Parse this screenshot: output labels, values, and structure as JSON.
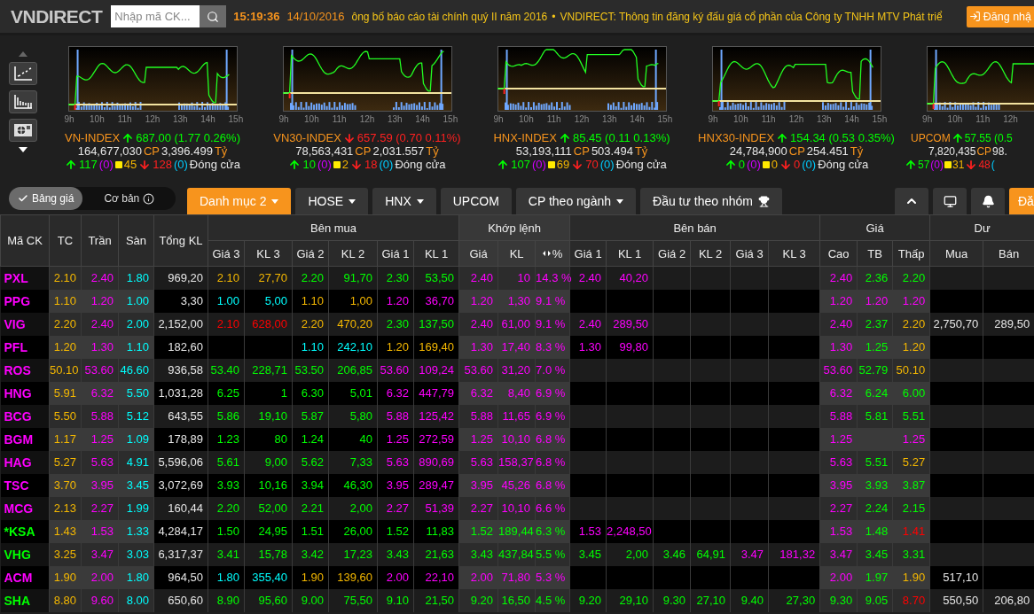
{
  "header": {
    "logo": "VNDIRECT",
    "search": {
      "placeholder": "Nhập mã CK..."
    },
    "time": "15:19:36",
    "date": "14/10/2016",
    "news": [
      "ông bố báo cáo tài chính quý II năm 2016",
      "VNDIRECT: Thông tin đăng ký đấu giá cổ phần của Công ty TNHH MTV Phát triể"
    ],
    "news_separator": "•",
    "login": "Đăng nhậ"
  },
  "indices": [
    {
      "name": "VN-INDEX",
      "kind": "up",
      "change": "687.00 (1.77 0.26%)",
      "volume": "164,677,030",
      "volume_unit": "CP",
      "value": "3,396.499",
      "value_unit": "Tỷ",
      "advances": "117",
      "ceiling_count": "(0)",
      "unchanged": "45",
      "declines": "128",
      "floor_count": "(0)",
      "status": "Đóng cửa",
      "hours": [
        "9h",
        "10h",
        "11h",
        "12h",
        "13h",
        "14h",
        "15h"
      ]
    },
    {
      "name": "VN30-INDEX",
      "kind": "down",
      "change": "657.59 (0.70 0.11%)",
      "volume": "78,563,431",
      "volume_unit": "CP",
      "value": "2,031.557",
      "value_unit": "Tỷ",
      "advances": "10",
      "ceiling_count": "(0)",
      "unchanged": "2",
      "declines": "18",
      "floor_count": "(0)",
      "status": "Đóng cửa",
      "hours": [
        "9h",
        "10h",
        "11h",
        "12h",
        "13h",
        "14h",
        "15h"
      ]
    },
    {
      "name": "HNX-INDEX",
      "kind": "up",
      "change": "85.45 (0.11 0.13%)",
      "volume": "53,193,111",
      "volume_unit": "CP",
      "value": "503.494",
      "value_unit": "Tỷ",
      "advances": "107",
      "ceiling_count": "(0)",
      "unchanged": "69",
      "declines": "70",
      "floor_count": "(0)",
      "status": "Đóng cửa",
      "hours": [
        "9h",
        "10h",
        "11h",
        "12h",
        "13h",
        "14h",
        "15h"
      ]
    },
    {
      "name": "HNX30-INDEX",
      "kind": "up",
      "change": "154.34 (0.53 0.35%)",
      "volume": "24,784,900",
      "volume_unit": "CP",
      "value": "254.451",
      "value_unit": "Tỷ",
      "advances": "0",
      "ceiling_count": "(0)",
      "unchanged": "0",
      "declines": "0",
      "floor_count": "(0)",
      "status": "Đóng cửa",
      "hours": [
        "9h",
        "10h",
        "11h",
        "12h",
        "13h",
        "14h",
        "15h"
      ]
    },
    {
      "name": "UPCOM",
      "kind": "up",
      "change": "57.55 (0.5",
      "volume": "7,820,435",
      "volume_unit": "CP",
      "value": "98.",
      "advances": "57",
      "ceiling_count": "(0)",
      "unchanged": "31",
      "declines": "48",
      "floor_count": "(",
      "hours": [
        "9h",
        "10h",
        "11h",
        "12h"
      ]
    }
  ],
  "view_toggle": [
    {
      "label": "Bảng giá",
      "selected": true
    },
    {
      "label": "Cơ bản",
      "selected": false
    }
  ],
  "tabs": [
    {
      "label": "Danh mục 2",
      "selected": true,
      "kind": "menu"
    },
    {
      "label": "HOSE",
      "selected": false,
      "kind": "menu"
    },
    {
      "label": "HNX",
      "selected": false,
      "kind": "menu"
    },
    {
      "label": "UPCOM",
      "selected": false,
      "kind": "plain"
    },
    {
      "label": "CP theo ngành",
      "selected": false,
      "kind": "menu"
    },
    {
      "label": "Đầu tư theo nhóm",
      "selected": false,
      "kind": "trophy"
    }
  ],
  "edge_button": "Đă",
  "table": {
    "columns": [
      {
        "label": "Mã CK"
      },
      {
        "label": "TC"
      },
      {
        "label": "Trần"
      },
      {
        "label": "Sàn"
      },
      {
        "label": "Tổng KL"
      },
      {
        "label": "Bên mua",
        "colspan": 6,
        "children": [
          {
            "label": "Giá 3"
          },
          {
            "label": "KL 3"
          },
          {
            "label": "Giá 2"
          },
          {
            "label": "KL 2"
          },
          {
            "label": "Giá 1"
          },
          {
            "label": "KL 1"
          }
        ]
      },
      {
        "label": "Khớp lệnh",
        "colspan": 3,
        "children": [
          {
            "label": "Giá"
          },
          {
            "label": "KL"
          },
          {
            "label": "%",
            "kind": "sort"
          }
        ]
      },
      {
        "label": "Bên bán",
        "colspan": 6,
        "children": [
          {
            "label": "Giá 1"
          },
          {
            "label": "KL 1"
          },
          {
            "label": "Giá 2"
          },
          {
            "label": "KL 2"
          },
          {
            "label": "Giá 3"
          },
          {
            "label": "KL 3"
          }
        ]
      },
      {
        "label": "Giá",
        "colspan": 3,
        "children": [
          {
            "label": "Cao"
          },
          {
            "label": "TB"
          },
          {
            "label": "Thấp"
          }
        ]
      },
      {
        "label": "Dư",
        "colspan": 2,
        "children": [
          {
            "label": "Mua"
          },
          {
            "label": "Bán"
          }
        ]
      }
    ],
    "rows": [
      {
        "cells": [
          {
            "v": "PXL",
            "color": "#ff00ff"
          },
          {
            "v": "2.10",
            "color": "#f5b800"
          },
          {
            "v": "2.40",
            "color": "#ff00ff"
          },
          {
            "v": "1.80",
            "color": "#00ffff"
          },
          {
            "v": "969,20",
            "color": "#e6e6e6"
          },
          {
            "v": "2.10",
            "color": "#f5b800"
          },
          {
            "v": "27,70",
            "color": "#f5b800"
          },
          {
            "v": "2.20",
            "color": "#00ff00"
          },
          {
            "v": "91,70",
            "color": "#00ff00"
          },
          {
            "v": "2.30",
            "color": "#00ff00"
          },
          {
            "v": "53,50",
            "color": "#00ff00"
          },
          {
            "v": "2.40",
            "color": "#ff00ff"
          },
          {
            "v": "10",
            "color": "#ff00ff"
          },
          {
            "v": "14.3 %",
            "color": "#ff00ff"
          },
          {
            "v": "2.40",
            "color": "#ff00ff"
          },
          {
            "v": "40,20",
            "color": "#ff00ff"
          },
          null,
          null,
          null,
          null,
          {
            "v": "2.40",
            "color": "#ff00ff"
          },
          {
            "v": "2.36",
            "color": "#00ff00"
          },
          {
            "v": "2.20",
            "color": "#00ff00"
          },
          null,
          null
        ]
      },
      {
        "cells": [
          {
            "v": "PPG",
            "color": "#ff00ff"
          },
          {
            "v": "1.10",
            "color": "#f5b800"
          },
          {
            "v": "1.20",
            "color": "#ff00ff"
          },
          {
            "v": "1.00",
            "color": "#00ffff"
          },
          {
            "v": "3,30",
            "color": "#e6e6e6"
          },
          {
            "v": "1.00",
            "color": "#00ffff"
          },
          {
            "v": "5,00",
            "color": "#00ffff"
          },
          {
            "v": "1.10",
            "color": "#f5b800"
          },
          {
            "v": "1,00",
            "color": "#f5b800"
          },
          {
            "v": "1.20",
            "color": "#ff00ff"
          },
          {
            "v": "36,70",
            "color": "#ff00ff"
          },
          {
            "v": "1.20",
            "color": "#ff00ff"
          },
          {
            "v": "1,30",
            "color": "#ff00ff"
          },
          {
            "v": "9.1 %",
            "color": "#ff00ff"
          },
          null,
          null,
          null,
          null,
          null,
          null,
          {
            "v": "1.20",
            "color": "#ff00ff"
          },
          {
            "v": "1.20",
            "color": "#ff00ff"
          },
          {
            "v": "1.20",
            "color": "#ff00ff"
          },
          null,
          null
        ]
      },
      {
        "cells": [
          {
            "v": "VIG",
            "color": "#ff00ff"
          },
          {
            "v": "2.20",
            "color": "#f5b800"
          },
          {
            "v": "2.40",
            "color": "#ff00ff"
          },
          {
            "v": "2.00",
            "color": "#00ffff"
          },
          {
            "v": "2,152,00",
            "color": "#e6e6e6"
          },
          {
            "v": "2.10",
            "color": "#ff0000"
          },
          {
            "v": "628,00",
            "color": "#ff0000"
          },
          {
            "v": "2.20",
            "color": "#f5b800"
          },
          {
            "v": "470,20",
            "color": "#f5b800"
          },
          {
            "v": "2.30",
            "color": "#00ff00"
          },
          {
            "v": "137,50",
            "color": "#00ff00"
          },
          {
            "v": "2.40",
            "color": "#ff00ff"
          },
          {
            "v": "61,00",
            "color": "#ff00ff"
          },
          {
            "v": "9.1 %",
            "color": "#ff00ff"
          },
          {
            "v": "2.40",
            "color": "#ff00ff"
          },
          {
            "v": "289,50",
            "color": "#ff00ff"
          },
          null,
          null,
          null,
          null,
          {
            "v": "2.40",
            "color": "#ff00ff"
          },
          {
            "v": "2.37",
            "color": "#00ff00"
          },
          {
            "v": "2.20",
            "color": "#f5b800"
          },
          {
            "v": "2,750,70",
            "color": "#e6e6e6"
          },
          {
            "v": "289,50",
            "color": "#e6e6e6"
          }
        ]
      },
      {
        "cells": [
          {
            "v": "PFL",
            "color": "#ff00ff"
          },
          {
            "v": "1.20",
            "color": "#f5b800"
          },
          {
            "v": "1.30",
            "color": "#ff00ff"
          },
          {
            "v": "1.10",
            "color": "#00ffff"
          },
          {
            "v": "182,60",
            "color": "#e6e6e6"
          },
          null,
          null,
          {
            "v": "1.10",
            "color": "#00ffff"
          },
          {
            "v": "242,10",
            "color": "#00ffff"
          },
          {
            "v": "1.20",
            "color": "#f5b800"
          },
          {
            "v": "169,40",
            "color": "#f5b800"
          },
          {
            "v": "1.30",
            "color": "#ff00ff"
          },
          {
            "v": "17,40",
            "color": "#ff00ff"
          },
          {
            "v": "8.3 %",
            "color": "#ff00ff"
          },
          {
            "v": "1.30",
            "color": "#ff00ff"
          },
          {
            "v": "99,80",
            "color": "#ff00ff"
          },
          null,
          null,
          null,
          null,
          {
            "v": "1.30",
            "color": "#ff00ff"
          },
          {
            "v": "1.25",
            "color": "#00ff00"
          },
          {
            "v": "1.20",
            "color": "#f5b800"
          },
          null,
          null
        ]
      },
      {
        "cells": [
          {
            "v": "ROS",
            "color": "#ff00ff"
          },
          {
            "v": "50.10",
            "color": "#f5b800"
          },
          {
            "v": "53.60",
            "color": "#ff00ff"
          },
          {
            "v": "46.60",
            "color": "#00ffff"
          },
          {
            "v": "936,58",
            "color": "#e6e6e6"
          },
          {
            "v": "53.40",
            "color": "#00ff00"
          },
          {
            "v": "228,71",
            "color": "#00ff00"
          },
          {
            "v": "53.50",
            "color": "#00ff00"
          },
          {
            "v": "206,85",
            "color": "#00ff00"
          },
          {
            "v": "53.60",
            "color": "#ff00ff"
          },
          {
            "v": "109,24",
            "color": "#ff00ff"
          },
          {
            "v": "53.60",
            "color": "#ff00ff"
          },
          {
            "v": "31,20",
            "color": "#ff00ff"
          },
          {
            "v": "7.0 %",
            "color": "#ff00ff"
          },
          null,
          null,
          null,
          null,
          null,
          null,
          {
            "v": "53.60",
            "color": "#ff00ff"
          },
          {
            "v": "52.79",
            "color": "#00ff00"
          },
          {
            "v": "50.10",
            "color": "#f5b800"
          },
          null,
          null
        ]
      },
      {
        "cells": [
          {
            "v": "HNG",
            "color": "#ff00ff"
          },
          {
            "v": "5.91",
            "color": "#f5b800"
          },
          {
            "v": "6.32",
            "color": "#ff00ff"
          },
          {
            "v": "5.50",
            "color": "#00ffff"
          },
          {
            "v": "1,031,28",
            "color": "#e6e6e6"
          },
          {
            "v": "6.25",
            "color": "#00ff00"
          },
          {
            "v": "1",
            "color": "#00ff00"
          },
          {
            "v": "6.30",
            "color": "#00ff00"
          },
          {
            "v": "5,01",
            "color": "#00ff00"
          },
          {
            "v": "6.32",
            "color": "#ff00ff"
          },
          {
            "v": "447,79",
            "color": "#ff00ff"
          },
          {
            "v": "6.32",
            "color": "#ff00ff"
          },
          {
            "v": "8,40",
            "color": "#ff00ff"
          },
          {
            "v": "6.9 %",
            "color": "#ff00ff"
          },
          null,
          null,
          null,
          null,
          null,
          null,
          {
            "v": "6.32",
            "color": "#ff00ff"
          },
          {
            "v": "6.24",
            "color": "#00ff00"
          },
          {
            "v": "6.00",
            "color": "#00ff00"
          },
          null,
          null
        ]
      },
      {
        "cells": [
          {
            "v": "BCG",
            "color": "#ff00ff"
          },
          {
            "v": "5.50",
            "color": "#f5b800"
          },
          {
            "v": "5.88",
            "color": "#ff00ff"
          },
          {
            "v": "5.12",
            "color": "#00ffff"
          },
          {
            "v": "643,55",
            "color": "#e6e6e6"
          },
          {
            "v": "5.86",
            "color": "#00ff00"
          },
          {
            "v": "19,10",
            "color": "#00ff00"
          },
          {
            "v": "5.87",
            "color": "#00ff00"
          },
          {
            "v": "5,80",
            "color": "#00ff00"
          },
          {
            "v": "5.88",
            "color": "#ff00ff"
          },
          {
            "v": "125,42",
            "color": "#ff00ff"
          },
          {
            "v": "5.88",
            "color": "#ff00ff"
          },
          {
            "v": "11,65",
            "color": "#ff00ff"
          },
          {
            "v": "6.9 %",
            "color": "#ff00ff"
          },
          null,
          null,
          null,
          null,
          null,
          null,
          {
            "v": "5.88",
            "color": "#ff00ff"
          },
          {
            "v": "5.81",
            "color": "#00ff00"
          },
          {
            "v": "5.51",
            "color": "#00ff00"
          },
          null,
          null
        ]
      },
      {
        "cells": [
          {
            "v": "BGM",
            "color": "#ff00ff"
          },
          {
            "v": "1.17",
            "color": "#f5b800"
          },
          {
            "v": "1.25",
            "color": "#ff00ff"
          },
          {
            "v": "1.09",
            "color": "#00ffff"
          },
          {
            "v": "178,89",
            "color": "#e6e6e6"
          },
          {
            "v": "1.23",
            "color": "#00ff00"
          },
          {
            "v": "80",
            "color": "#00ff00"
          },
          {
            "v": "1.24",
            "color": "#00ff00"
          },
          {
            "v": "40",
            "color": "#00ff00"
          },
          {
            "v": "1.25",
            "color": "#ff00ff"
          },
          {
            "v": "272,59",
            "color": "#ff00ff"
          },
          {
            "v": "1.25",
            "color": "#ff00ff"
          },
          {
            "v": "10,10",
            "color": "#ff00ff"
          },
          {
            "v": "6.8 %",
            "color": "#ff00ff"
          },
          null,
          null,
          null,
          null,
          null,
          null,
          {
            "v": "1.25",
            "color": "#ff00ff"
          },
          null,
          {
            "v": "1.25",
            "color": "#ff00ff"
          },
          null,
          null
        ]
      },
      {
        "cells": [
          {
            "v": "HAG",
            "color": "#ff00ff"
          },
          {
            "v": "5.27",
            "color": "#f5b800"
          },
          {
            "v": "5.63",
            "color": "#ff00ff"
          },
          {
            "v": "4.91",
            "color": "#00ffff"
          },
          {
            "v": "5,596,06",
            "color": "#e6e6e6"
          },
          {
            "v": "5.61",
            "color": "#00ff00"
          },
          {
            "v": "9,00",
            "color": "#00ff00"
          },
          {
            "v": "5.62",
            "color": "#00ff00"
          },
          {
            "v": "7,33",
            "color": "#00ff00"
          },
          {
            "v": "5.63",
            "color": "#ff00ff"
          },
          {
            "v": "890,69",
            "color": "#ff00ff"
          },
          {
            "v": "5.63",
            "color": "#ff00ff"
          },
          {
            "v": "158,37",
            "color": "#ff00ff"
          },
          {
            "v": "6.8 %",
            "color": "#ff00ff"
          },
          null,
          null,
          null,
          null,
          null,
          null,
          {
            "v": "5.63",
            "color": "#ff00ff"
          },
          {
            "v": "5.51",
            "color": "#00ff00"
          },
          {
            "v": "5.27",
            "color": "#f5b800"
          },
          null,
          null
        ]
      },
      {
        "cells": [
          {
            "v": "TSC",
            "color": "#ff00ff"
          },
          {
            "v": "3.70",
            "color": "#f5b800"
          },
          {
            "v": "3.95",
            "color": "#ff00ff"
          },
          {
            "v": "3.45",
            "color": "#00ffff"
          },
          {
            "v": "3,072,69",
            "color": "#e6e6e6"
          },
          {
            "v": "3.93",
            "color": "#00ff00"
          },
          {
            "v": "10,16",
            "color": "#00ff00"
          },
          {
            "v": "3.94",
            "color": "#00ff00"
          },
          {
            "v": "46,30",
            "color": "#00ff00"
          },
          {
            "v": "3.95",
            "color": "#ff00ff"
          },
          {
            "v": "289,47",
            "color": "#ff00ff"
          },
          {
            "v": "3.95",
            "color": "#ff00ff"
          },
          {
            "v": "45,26",
            "color": "#ff00ff"
          },
          {
            "v": "6.8 %",
            "color": "#ff00ff"
          },
          null,
          null,
          null,
          null,
          null,
          null,
          {
            "v": "3.95",
            "color": "#ff00ff"
          },
          {
            "v": "3.93",
            "color": "#00ff00"
          },
          {
            "v": "3.87",
            "color": "#00ff00"
          },
          null,
          null
        ]
      },
      {
        "cells": [
          {
            "v": "MCG",
            "color": "#ff00ff"
          },
          {
            "v": "2.13",
            "color": "#f5b800"
          },
          {
            "v": "2.27",
            "color": "#ff00ff"
          },
          {
            "v": "1.99",
            "color": "#00ffff"
          },
          {
            "v": "160,44",
            "color": "#e6e6e6"
          },
          {
            "v": "2.20",
            "color": "#00ff00"
          },
          {
            "v": "52,00",
            "color": "#00ff00"
          },
          {
            "v": "2.21",
            "color": "#00ff00"
          },
          {
            "v": "2,00",
            "color": "#00ff00"
          },
          {
            "v": "2.27",
            "color": "#ff00ff"
          },
          {
            "v": "51,39",
            "color": "#ff00ff"
          },
          {
            "v": "2.27",
            "color": "#ff00ff"
          },
          {
            "v": "10,10",
            "color": "#ff00ff"
          },
          {
            "v": "6.6 %",
            "color": "#ff00ff"
          },
          null,
          null,
          null,
          null,
          null,
          null,
          {
            "v": "2.27",
            "color": "#ff00ff"
          },
          {
            "v": "2.24",
            "color": "#00ff00"
          },
          {
            "v": "2.15",
            "color": "#00ff00"
          },
          null,
          null
        ]
      },
      {
        "cells": [
          {
            "v": "*KSA",
            "color": "#00ff00"
          },
          {
            "v": "1.43",
            "color": "#f5b800"
          },
          {
            "v": "1.53",
            "color": "#ff00ff"
          },
          {
            "v": "1.33",
            "color": "#00ffff"
          },
          {
            "v": "4,284,17",
            "color": "#e6e6e6"
          },
          {
            "v": "1.50",
            "color": "#00ff00"
          },
          {
            "v": "24,95",
            "color": "#00ff00"
          },
          {
            "v": "1.51",
            "color": "#00ff00"
          },
          {
            "v": "26,00",
            "color": "#00ff00"
          },
          {
            "v": "1.52",
            "color": "#00ff00"
          },
          {
            "v": "11,83",
            "color": "#00ff00"
          },
          {
            "v": "1.52",
            "color": "#00ff00"
          },
          {
            "v": "189,44",
            "color": "#00ff00"
          },
          {
            "v": "6.3 %",
            "color": "#00ff00"
          },
          {
            "v": "1.53",
            "color": "#ff00ff"
          },
          {
            "v": "2,248,50",
            "color": "#ff00ff"
          },
          null,
          null,
          null,
          null,
          {
            "v": "1.53",
            "color": "#ff00ff"
          },
          {
            "v": "1.48",
            "color": "#00ff00"
          },
          {
            "v": "1.41",
            "color": "#ff0000"
          },
          null,
          null
        ]
      },
      {
        "cells": [
          {
            "v": "VHG",
            "color": "#00ff00"
          },
          {
            "v": "3.25",
            "color": "#f5b800"
          },
          {
            "v": "3.47",
            "color": "#ff00ff"
          },
          {
            "v": "3.03",
            "color": "#00ffff"
          },
          {
            "v": "6,317,37",
            "color": "#e6e6e6"
          },
          {
            "v": "3.41",
            "color": "#00ff00"
          },
          {
            "v": "15,78",
            "color": "#00ff00"
          },
          {
            "v": "3.42",
            "color": "#00ff00"
          },
          {
            "v": "17,23",
            "color": "#00ff00"
          },
          {
            "v": "3.43",
            "color": "#00ff00"
          },
          {
            "v": "21,63",
            "color": "#00ff00"
          },
          {
            "v": "3.43",
            "color": "#00ff00"
          },
          {
            "v": "437,84",
            "color": "#00ff00"
          },
          {
            "v": "5.5 %",
            "color": "#00ff00"
          },
          {
            "v": "3.45",
            "color": "#00ff00"
          },
          {
            "v": "2,00",
            "color": "#00ff00"
          },
          {
            "v": "3.46",
            "color": "#00ff00"
          },
          {
            "v": "64,91",
            "color": "#00ff00"
          },
          {
            "v": "3.47",
            "color": "#ff00ff"
          },
          {
            "v": "181,32",
            "color": "#ff00ff"
          },
          {
            "v": "3.47",
            "color": "#ff00ff"
          },
          {
            "v": "3.45",
            "color": "#00ff00"
          },
          {
            "v": "3.31",
            "color": "#00ff00"
          },
          null,
          null
        ]
      },
      {
        "cells": [
          {
            "v": "ACM",
            "color": "#ff00ff"
          },
          {
            "v": "1.90",
            "color": "#f5b800"
          },
          {
            "v": "2.00",
            "color": "#ff00ff"
          },
          {
            "v": "1.80",
            "color": "#00ffff"
          },
          {
            "v": "964,50",
            "color": "#e6e6e6"
          },
          {
            "v": "1.80",
            "color": "#00ffff"
          },
          {
            "v": "355,40",
            "color": "#00ffff"
          },
          {
            "v": "1.90",
            "color": "#f5b800"
          },
          {
            "v": "139,60",
            "color": "#f5b800"
          },
          {
            "v": "2.00",
            "color": "#ff00ff"
          },
          {
            "v": "22,10",
            "color": "#ff00ff"
          },
          {
            "v": "2.00",
            "color": "#ff00ff"
          },
          {
            "v": "71,80",
            "color": "#ff00ff"
          },
          {
            "v": "5.3 %",
            "color": "#ff00ff"
          },
          null,
          null,
          null,
          null,
          null,
          null,
          {
            "v": "2.00",
            "color": "#ff00ff"
          },
          {
            "v": "1.97",
            "color": "#00ff00"
          },
          {
            "v": "1.90",
            "color": "#f5b800"
          },
          {
            "v": "517,10",
            "color": "#e6e6e6"
          },
          null
        ]
      },
      {
        "cells": [
          {
            "v": "SHA",
            "color": "#00ff00"
          },
          {
            "v": "8.80",
            "color": "#f5b800"
          },
          {
            "v": "9.60",
            "color": "#ff00ff"
          },
          {
            "v": "8.00",
            "color": "#00ffff"
          },
          {
            "v": "650,60",
            "color": "#e6e6e6"
          },
          {
            "v": "8.90",
            "color": "#00ff00"
          },
          {
            "v": "95,60",
            "color": "#00ff00"
          },
          {
            "v": "9.00",
            "color": "#00ff00"
          },
          {
            "v": "75,50",
            "color": "#00ff00"
          },
          {
            "v": "9.10",
            "color": "#00ff00"
          },
          {
            "v": "21,50",
            "color": "#00ff00"
          },
          {
            "v": "9.20",
            "color": "#00ff00"
          },
          {
            "v": "16,50",
            "color": "#00ff00"
          },
          {
            "v": "4.5 %",
            "color": "#00ff00"
          },
          {
            "v": "9.20",
            "color": "#00ff00"
          },
          {
            "v": "29,10",
            "color": "#00ff00"
          },
          {
            "v": "9.30",
            "color": "#00ff00"
          },
          {
            "v": "27,10",
            "color": "#00ff00"
          },
          {
            "v": "9.40",
            "color": "#00ff00"
          },
          {
            "v": "27,30",
            "color": "#00ff00"
          },
          {
            "v": "9.30",
            "color": "#00ff00"
          },
          {
            "v": "9.05",
            "color": "#00ff00"
          },
          {
            "v": "8.70",
            "color": "#ff0000"
          },
          {
            "v": "550,50",
            "color": "#e6e6e6"
          },
          {
            "v": "206,80",
            "color": "#e6e6e6"
          }
        ]
      }
    ]
  }
}
